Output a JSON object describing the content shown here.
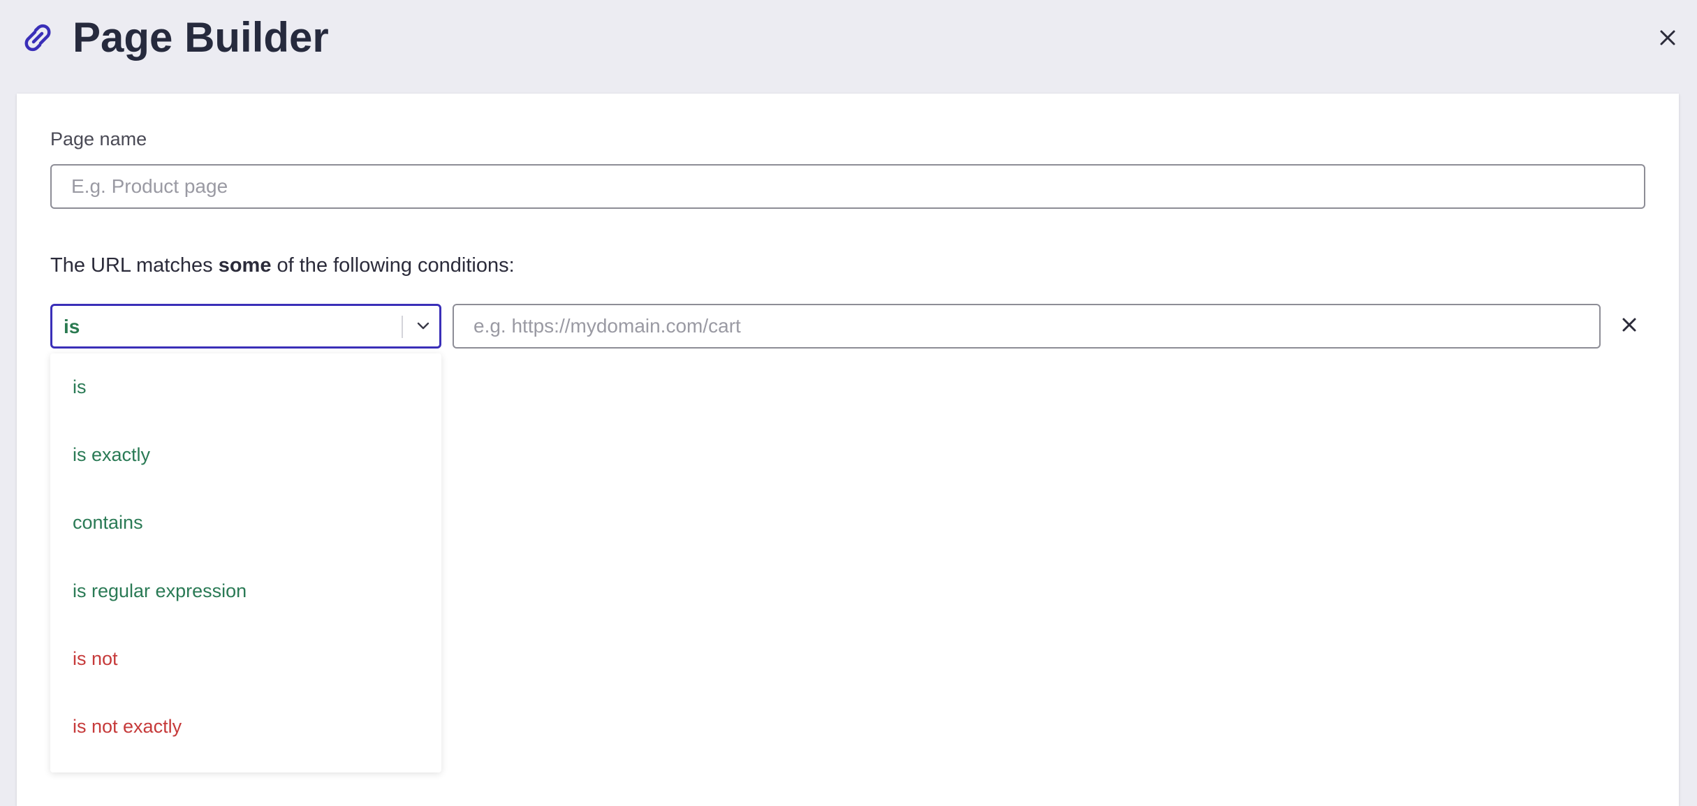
{
  "header": {
    "title": "Page Builder",
    "logo_icon": "link-icon",
    "close_icon": "close-icon"
  },
  "form": {
    "page_name_label": "Page name",
    "page_name_value": "",
    "page_name_placeholder": "E.g. Product page",
    "conditions_prefix": "The URL matches ",
    "conditions_emphasis": "some",
    "conditions_suffix": " of the following conditions:"
  },
  "condition": {
    "operator_selected": "is",
    "url_value": "",
    "url_placeholder": "e.g. https://mydomain.com/cart",
    "remove_icon": "close-icon"
  },
  "dropdown": {
    "options": [
      {
        "label": "is",
        "tone": "positive"
      },
      {
        "label": "is exactly",
        "tone": "positive"
      },
      {
        "label": "contains",
        "tone": "positive"
      },
      {
        "label": "is regular expression",
        "tone": "positive"
      },
      {
        "label": "is not",
        "tone": "negative"
      },
      {
        "label": "is not exactly",
        "tone": "negative"
      }
    ]
  },
  "colors": {
    "accent": "#3a2fb8",
    "positive": "#2a7a55",
    "negative": "#c63a3a",
    "background": "#ececf2"
  }
}
